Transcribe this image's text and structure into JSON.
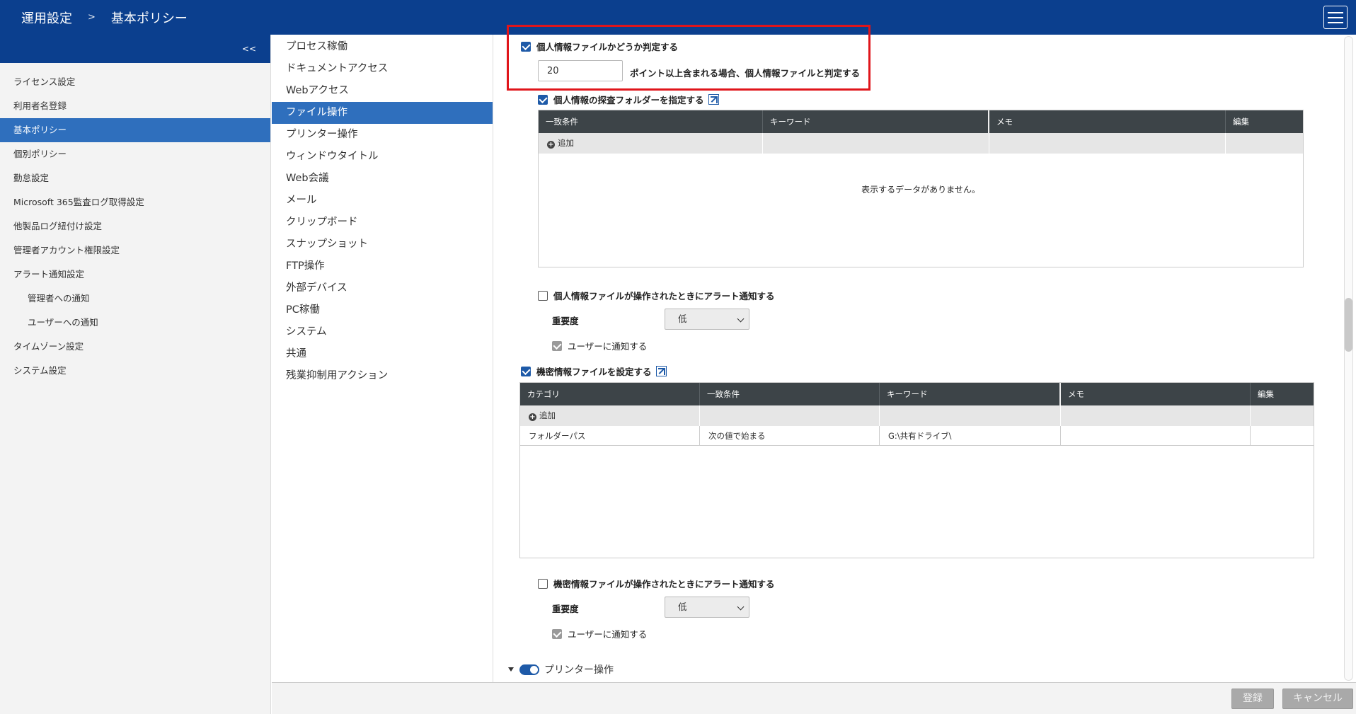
{
  "header": {
    "breadcrumb_parent": "運用設定",
    "breadcrumb_sep": ">",
    "breadcrumb_current": "基本ポリシー"
  },
  "sidebar": {
    "collapse_label": "<<",
    "items": [
      {
        "label": "ライセンス設定"
      },
      {
        "label": "利用者名登録"
      },
      {
        "label": "基本ポリシー"
      },
      {
        "label": "個別ポリシー"
      },
      {
        "label": "勤怠設定"
      },
      {
        "label": "Microsoft 365監査ログ取得設定"
      },
      {
        "label": "他製品ログ紐付け設定"
      },
      {
        "label": "管理者アカウント権限設定"
      },
      {
        "label": "アラート通知設定"
      },
      {
        "label": "管理者への通知"
      },
      {
        "label": "ユーザーへの通知"
      },
      {
        "label": "タイムゾーン設定"
      },
      {
        "label": "システム設定"
      }
    ]
  },
  "categories": [
    {
      "label": "プロセス稼働"
    },
    {
      "label": "ドキュメントアクセス"
    },
    {
      "label": "Webアクセス"
    },
    {
      "label": "ファイル操作"
    },
    {
      "label": "プリンター操作"
    },
    {
      "label": "ウィンドウタイトル"
    },
    {
      "label": "Web会議"
    },
    {
      "label": "メール"
    },
    {
      "label": "クリップボード"
    },
    {
      "label": "スナップショット"
    },
    {
      "label": "FTP操作"
    },
    {
      "label": "外部デバイス"
    },
    {
      "label": "PC稼働"
    },
    {
      "label": "システム"
    },
    {
      "label": "共通"
    },
    {
      "label": "残業抑制用アクション"
    }
  ],
  "personal": {
    "judge_label": "個人情報ファイルかどうか判定する",
    "threshold_value": "20",
    "threshold_suffix": "ポイント以上含まれる場合、個人情報ファイルと判定する",
    "folder_label": "個人情報の探査フォルダーを指定する",
    "table_headers": [
      "一致条件",
      "キーワード",
      "メモ",
      "編集"
    ],
    "add_label": "追加",
    "empty_message": "表示するデータがありません。",
    "alert_label": "個人情報ファイルが操作されたときにアラート通知する",
    "severity_label": "重要度",
    "severity_value": "低",
    "notify_user_label": "ユーザーに通知する"
  },
  "confidential": {
    "set_label": "機密情報ファイルを設定する",
    "table_headers": [
      "カテゴリ",
      "一致条件",
      "キーワード",
      "メモ",
      "編集"
    ],
    "add_label": "追加",
    "rows": [
      {
        "category": "フォルダーパス",
        "condition": "次の値で始まる",
        "keyword": "G:\\共有ドライブ\\",
        "memo": "",
        "edit": ""
      }
    ],
    "alert_label": "機密情報ファイルが操作されたときにアラート通知する",
    "severity_label": "重要度",
    "severity_value": "低",
    "notify_user_label": "ユーザーに通知する"
  },
  "next_section": {
    "label": "プリンター操作"
  },
  "footer": {
    "register_label": "登録",
    "cancel_label": "キャンセル"
  },
  "colors": {
    "brand_blue": "#0b3f8e",
    "active_blue": "#2f6fbd",
    "highlight_red": "#e0151b",
    "table_header": "#3d4448"
  }
}
